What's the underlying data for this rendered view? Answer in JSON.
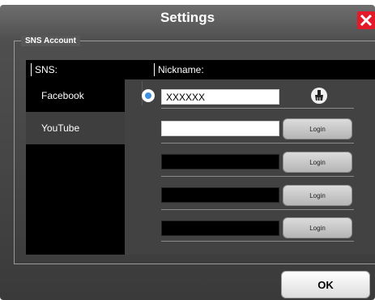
{
  "dialog": {
    "title": "Settings"
  },
  "group": {
    "title": "SNS Account"
  },
  "table": {
    "col_sns": "SNS:",
    "col_nickname": "Nickname:"
  },
  "sns_list": [
    {
      "label": "Facebook",
      "selected": true
    },
    {
      "label": "YouTube",
      "selected": false
    }
  ],
  "accounts": [
    {
      "nickname": "XXXXXX",
      "field": "white",
      "action": "clear"
    },
    {
      "nickname": "",
      "field": "white",
      "action": "Login"
    },
    {
      "nickname": "",
      "field": "black",
      "action": "Login"
    },
    {
      "nickname": "",
      "field": "black",
      "action": "Login"
    },
    {
      "nickname": "",
      "field": "black",
      "action": "Login"
    }
  ],
  "buttons": {
    "login": "Login",
    "ok": "OK"
  },
  "colors": {
    "close": "#e21a2a",
    "radio_selected": "#3d8fe0"
  }
}
